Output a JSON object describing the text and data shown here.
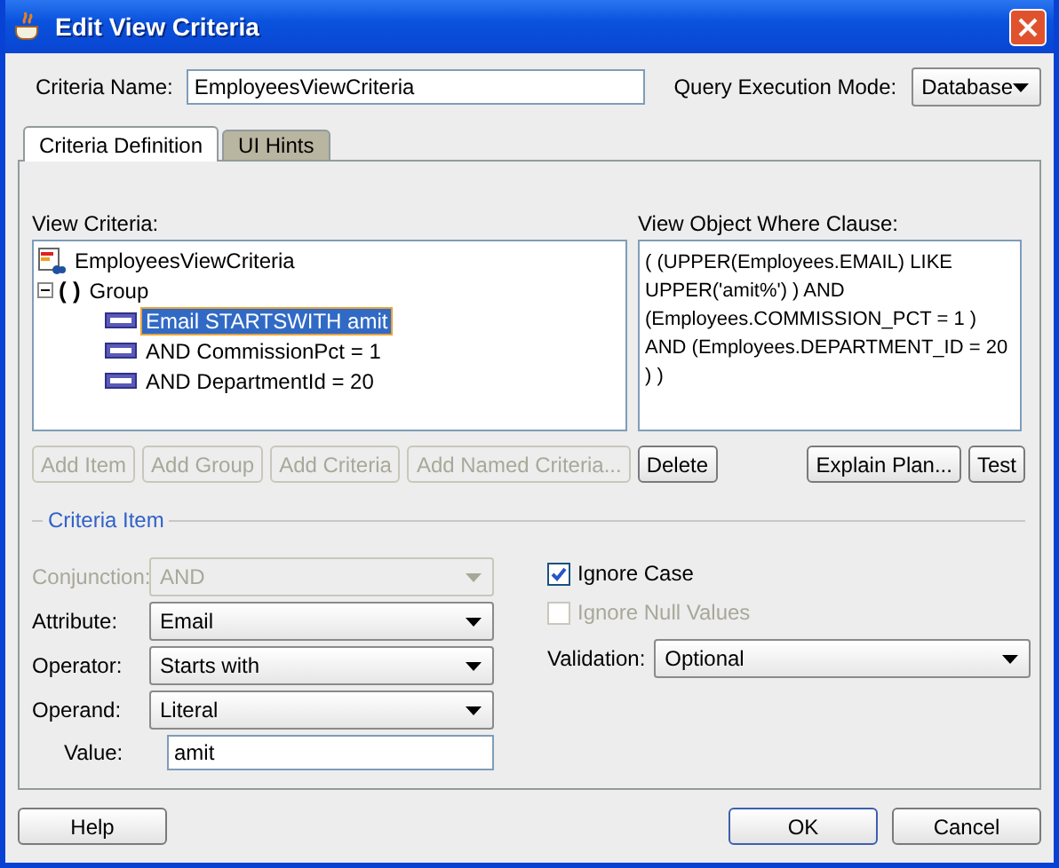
{
  "window": {
    "title": "Edit View Criteria"
  },
  "criteria_name": {
    "label": "Criteria Name:",
    "value": "EmployeesViewCriteria"
  },
  "query_mode": {
    "label": "Query Execution Mode:",
    "value": "Database"
  },
  "tabs": [
    {
      "label": "Criteria Definition",
      "selected": true
    },
    {
      "label": "UI Hints",
      "selected": false
    }
  ],
  "view_criteria": {
    "label": "View Criteria:",
    "tree": [
      {
        "label": "EmployeesViewCriteria",
        "kind": "root",
        "selected": false,
        "children": [
          {
            "label": "Group",
            "kind": "group",
            "glyph": "( )",
            "expanded": true,
            "selected": false,
            "children": [
              {
                "label": "Email STARTSWITH amit",
                "kind": "item",
                "selected": true
              },
              {
                "label": "AND CommissionPct = 1",
                "kind": "item",
                "selected": false
              },
              {
                "label": "AND DepartmentId = 20",
                "kind": "item",
                "selected": false
              }
            ]
          }
        ]
      }
    ]
  },
  "where_clause": {
    "label": "View Object Where Clause:",
    "text": "( (UPPER(Employees.EMAIL) LIKE UPPER('amit%') ) AND (Employees.COMMISSION_PCT = 1 ) AND (Employees.DEPARTMENT_ID = 20 ) )"
  },
  "tree_buttons": [
    {
      "label": "Add Item",
      "disabled": true
    },
    {
      "label": "Add Group",
      "disabled": true
    },
    {
      "label": "Add Criteria",
      "disabled": true
    },
    {
      "label": "Add Named Criteria...",
      "disabled": true
    },
    {
      "label": "Delete",
      "disabled": false
    }
  ],
  "clause_buttons": [
    {
      "label": "Explain Plan...",
      "disabled": false
    },
    {
      "label": "Test",
      "disabled": false
    }
  ],
  "criteria_item": {
    "title": "Criteria Item",
    "fields": [
      {
        "label": "Conjunction:",
        "kind": "select",
        "value": "AND",
        "disabled": true
      },
      {
        "label": "Attribute:",
        "kind": "select",
        "value": "Email",
        "disabled": false
      },
      {
        "label": "Operator:",
        "kind": "select",
        "value": "Starts with",
        "disabled": false
      },
      {
        "label": "Operand:",
        "kind": "select",
        "value": "Literal",
        "disabled": false
      },
      {
        "label": "Value:",
        "kind": "input",
        "value": "amit",
        "disabled": false
      }
    ],
    "options": [
      {
        "label": "Ignore Case",
        "checked": true,
        "disabled": false
      },
      {
        "label": "Ignore Null Values",
        "checked": false,
        "disabled": true
      }
    ],
    "validation": {
      "label": "Validation:",
      "value": "Optional"
    }
  },
  "footer": {
    "help": "Help",
    "buttons": [
      {
        "label": "OK",
        "default": true
      },
      {
        "label": "Cancel",
        "default": false
      }
    ]
  }
}
